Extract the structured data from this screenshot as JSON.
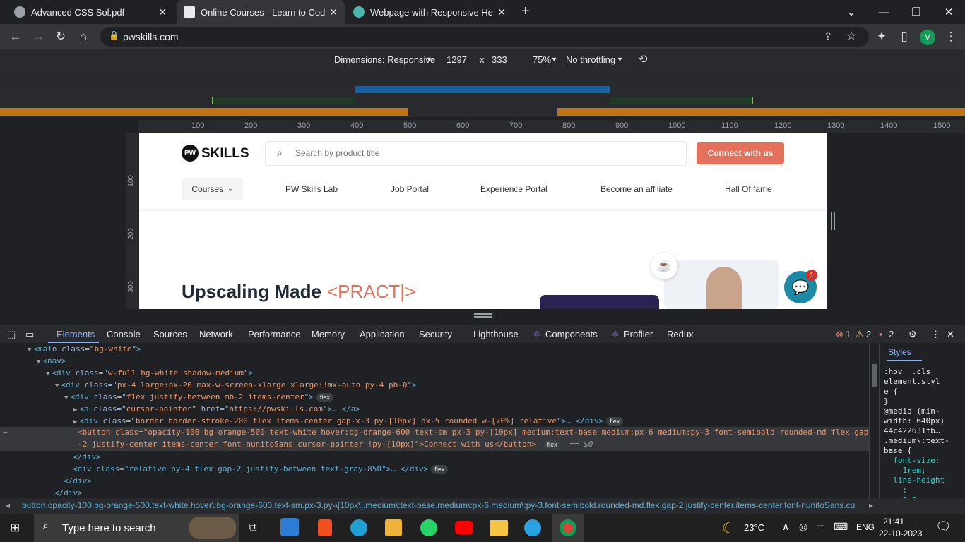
{
  "browser": {
    "tabs": [
      {
        "title": "Advanced CSS Sol.pdf",
        "active": false
      },
      {
        "title": "Online Courses - Learn to Code",
        "active": true
      },
      {
        "title": "Webpage with Responsive Head",
        "active": false
      }
    ],
    "new_tab": "+",
    "url": "pwskills.com",
    "profile_initial": "M"
  },
  "device_toolbar": {
    "dimensions": "Dimensions: Responsive",
    "width": "1297",
    "times": "x",
    "height": "333",
    "zoom": "75%",
    "throttling": "No throttling"
  },
  "ruler": {
    "h_ticks": [
      "100",
      "200",
      "300",
      "400",
      "500",
      "600",
      "700",
      "800",
      "900",
      "1000",
      "1100",
      "1200",
      "1300",
      "1400",
      "1500"
    ],
    "v_ticks": [
      "100",
      "200",
      "300"
    ]
  },
  "site": {
    "logo_text": "SKILLS",
    "search_placeholder": "Search by product title",
    "connect_label": "Connect with us",
    "courses_label": "Courses",
    "nav": [
      "PW Skills Lab",
      "Job Portal",
      "Experience Portal",
      "Become an affiliate",
      "Hall Of fame"
    ],
    "hero_text": "Upscaling Made",
    "hero_accent": "<PRACT|>",
    "chat_badge": "1"
  },
  "devtools": {
    "tabs": [
      "Elements",
      "Console",
      "Sources",
      "Network",
      "Performance",
      "Memory",
      "Application",
      "Security",
      "Lighthouse",
      "Components",
      "Profiler",
      "Redux"
    ],
    "errors": "1",
    "warnings": "2",
    "issues": "2",
    "code_lines": [
      {
        "indent": 3,
        "arrow": "▼",
        "tag": "main",
        "attrs": [
          [
            "class",
            "bg-white"
          ]
        ],
        "tail": ""
      },
      {
        "indent": 4,
        "arrow": "▼",
        "tag": "nav",
        "attrs": [],
        "tail": ""
      },
      {
        "indent": 5,
        "arrow": "▼",
        "tag": "div",
        "attrs": [
          [
            "class",
            "w-full bg-white shadow-medium"
          ]
        ],
        "tail": ""
      },
      {
        "indent": 6,
        "arrow": "▼",
        "tag": "div",
        "attrs": [
          [
            "class",
            "px-4 large:px-20 max-w-screen-xlarge xlarge:!mx-auto py-4 pb-0"
          ]
        ],
        "tail": ""
      },
      {
        "indent": 7,
        "arrow": "▼",
        "tag": "div",
        "attrs": [
          [
            "class",
            "flex justify-between mb-2 items-center"
          ]
        ],
        "tail": "",
        "pill": "flex"
      },
      {
        "indent": 8,
        "arrow": "▶",
        "tag": "a",
        "attrs": [
          [
            "class",
            "cursor-pointer"
          ],
          [
            "href",
            "https://pwskills.com"
          ]
        ],
        "tail": "… </a>"
      },
      {
        "indent": 8,
        "arrow": "▶",
        "tag": "div",
        "attrs": [
          [
            "class",
            "border border-stroke-200 flex items-center gap-x-3 py-[10px] px-5 rounded w-[70%] relative"
          ]
        ],
        "tail": "… </div>",
        "pill": "flex"
      }
    ],
    "selected_line": "<button class=\"opacity-100 bg-orange-500 text-white hover:bg-orange-600 text-sm px-3 py-[10px] medium:text-base medium:px-6 medium:py-3 font-semibold rounded-md flex gap",
    "selected_line2": "-2 justify-center items-center font-nunitoSans cursor-pointer !py-[10px]\">Connect with us</button>",
    "selected_pill": "flex",
    "selected_eq": "== $0",
    "after_lines": [
      {
        "indent": 7,
        "text": "</div>"
      },
      {
        "indent": 7,
        "text": "<div class=\"relative py-4 flex gap-2 justify-between text-gray-850\">… </div>",
        "pill": "flex"
      },
      {
        "indent": 6,
        "text": "</div>"
      },
      {
        "indent": 5,
        "text": "</div>"
      }
    ],
    "styles_tab": "Styles",
    "styles_lines": [
      ":hov  .cls",
      "element.styl",
      "e {",
      "}",
      "@media (min-",
      "width: 640px)",
      "44c422631fb…",
      ".medium\\:text-",
      "base {",
      "  font-size:",
      "    1rem;",
      "  line-height",
      "    :",
      "    1.5rem;"
    ],
    "breadcrumb": "button.opacity-100.bg-orange-500.text-white.hover\\:bg-orange-600.text-sm.px-3.py-\\[10px\\].medium\\:text-base.medium\\:px-6.medium\\:py-3.font-semibold.rounded-md.flex.gap-2.justify-center.items-center.font-nunitoSans.cu"
  },
  "taskbar": {
    "search_placeholder": "Type here to search",
    "weather": "23°C",
    "lang": "ENG",
    "time": "21:41",
    "date": "22-10-2023"
  },
  "colors": {
    "accent": "#e4715b",
    "chrome_bg": "#202124",
    "devtools_blue": "#8ab4f8"
  }
}
